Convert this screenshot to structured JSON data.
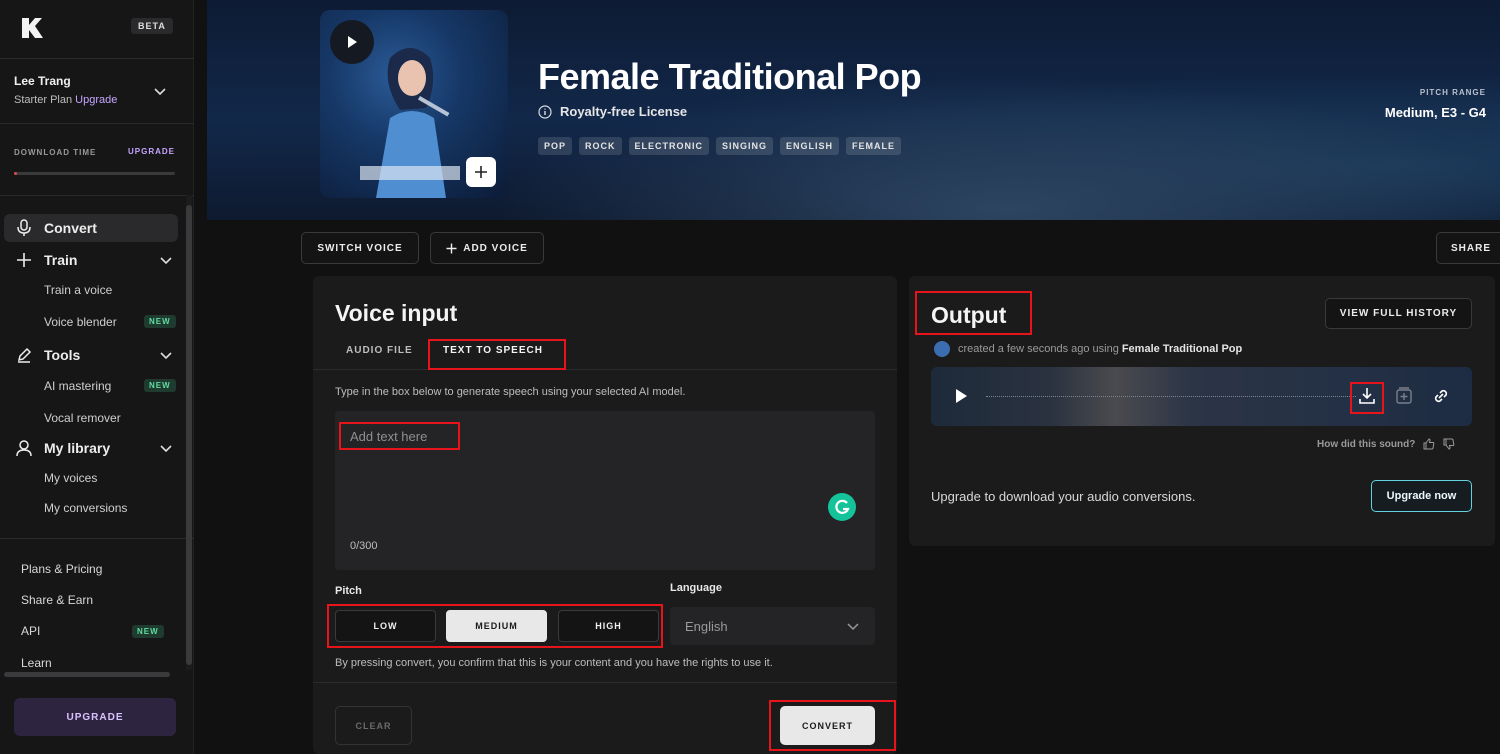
{
  "sidebar": {
    "beta": "BETA",
    "user_name": "Lee Trang",
    "plan": "Starter Plan",
    "plan_upgrade": "Upgrade",
    "download_time_label": "DOWNLOAD TIME",
    "download_time_upgrade": "UPGRADE",
    "download_time_used_fraction": 0.02,
    "nav": {
      "convert": "Convert",
      "train": "Train",
      "train_voice": "Train a voice",
      "voice_blender": "Voice blender",
      "tools": "Tools",
      "ai_mastering": "AI mastering",
      "vocal_remover": "Vocal remover",
      "my_library": "My library",
      "my_voices": "My voices",
      "my_conversions": "My conversions"
    },
    "new_badge": "NEW",
    "bottom": {
      "plans": "Plans & Pricing",
      "share": "Share & Earn",
      "api": "API",
      "learn": "Learn"
    },
    "upgrade_button": "UPGRADE"
  },
  "hero": {
    "title": "Female Traditional Pop",
    "license": "Royalty-free License",
    "tags": [
      "POP",
      "ROCK",
      "ELECTRONIC",
      "SINGING",
      "ENGLISH",
      "FEMALE"
    ],
    "pitch_range_label": "PITCH RANGE",
    "pitch_range_value": "Medium, E3 - G4"
  },
  "actions": {
    "switch_voice": "SWITCH VOICE",
    "add_voice": "ADD VOICE",
    "share": "SHARE"
  },
  "voice_input": {
    "title": "Voice input",
    "tabs": [
      "AUDIO FILE",
      "TEXT TO SPEECH"
    ],
    "helper": "Type in the box below to generate speech using your selected AI model.",
    "placeholder": "Add text here",
    "counter": "0/300",
    "pitch_label": "Pitch",
    "pitch_options": [
      "LOW",
      "MEDIUM",
      "HIGH"
    ],
    "pitch_selected": "MEDIUM",
    "language_label": "Language",
    "language_value": "English",
    "consent": "By pressing convert, you confirm that this is your content and you have the rights to use it.",
    "clear": "CLEAR",
    "convert": "CONVERT"
  },
  "output": {
    "title": "Output",
    "view_history": "VIEW FULL HISTORY",
    "created_prefix": "created a few seconds ago using",
    "created_voice": "Female Traditional Pop",
    "feedback": "How did this sound?",
    "upgrade_message": "Upgrade to download your audio conversions.",
    "upgrade_now": "Upgrade now"
  },
  "colors": {
    "highlight": "#e8141b",
    "accent_purple": "#c6a4ff",
    "new_green": "#5fdca0",
    "upgrade_now_border": "#5fd3e0"
  }
}
